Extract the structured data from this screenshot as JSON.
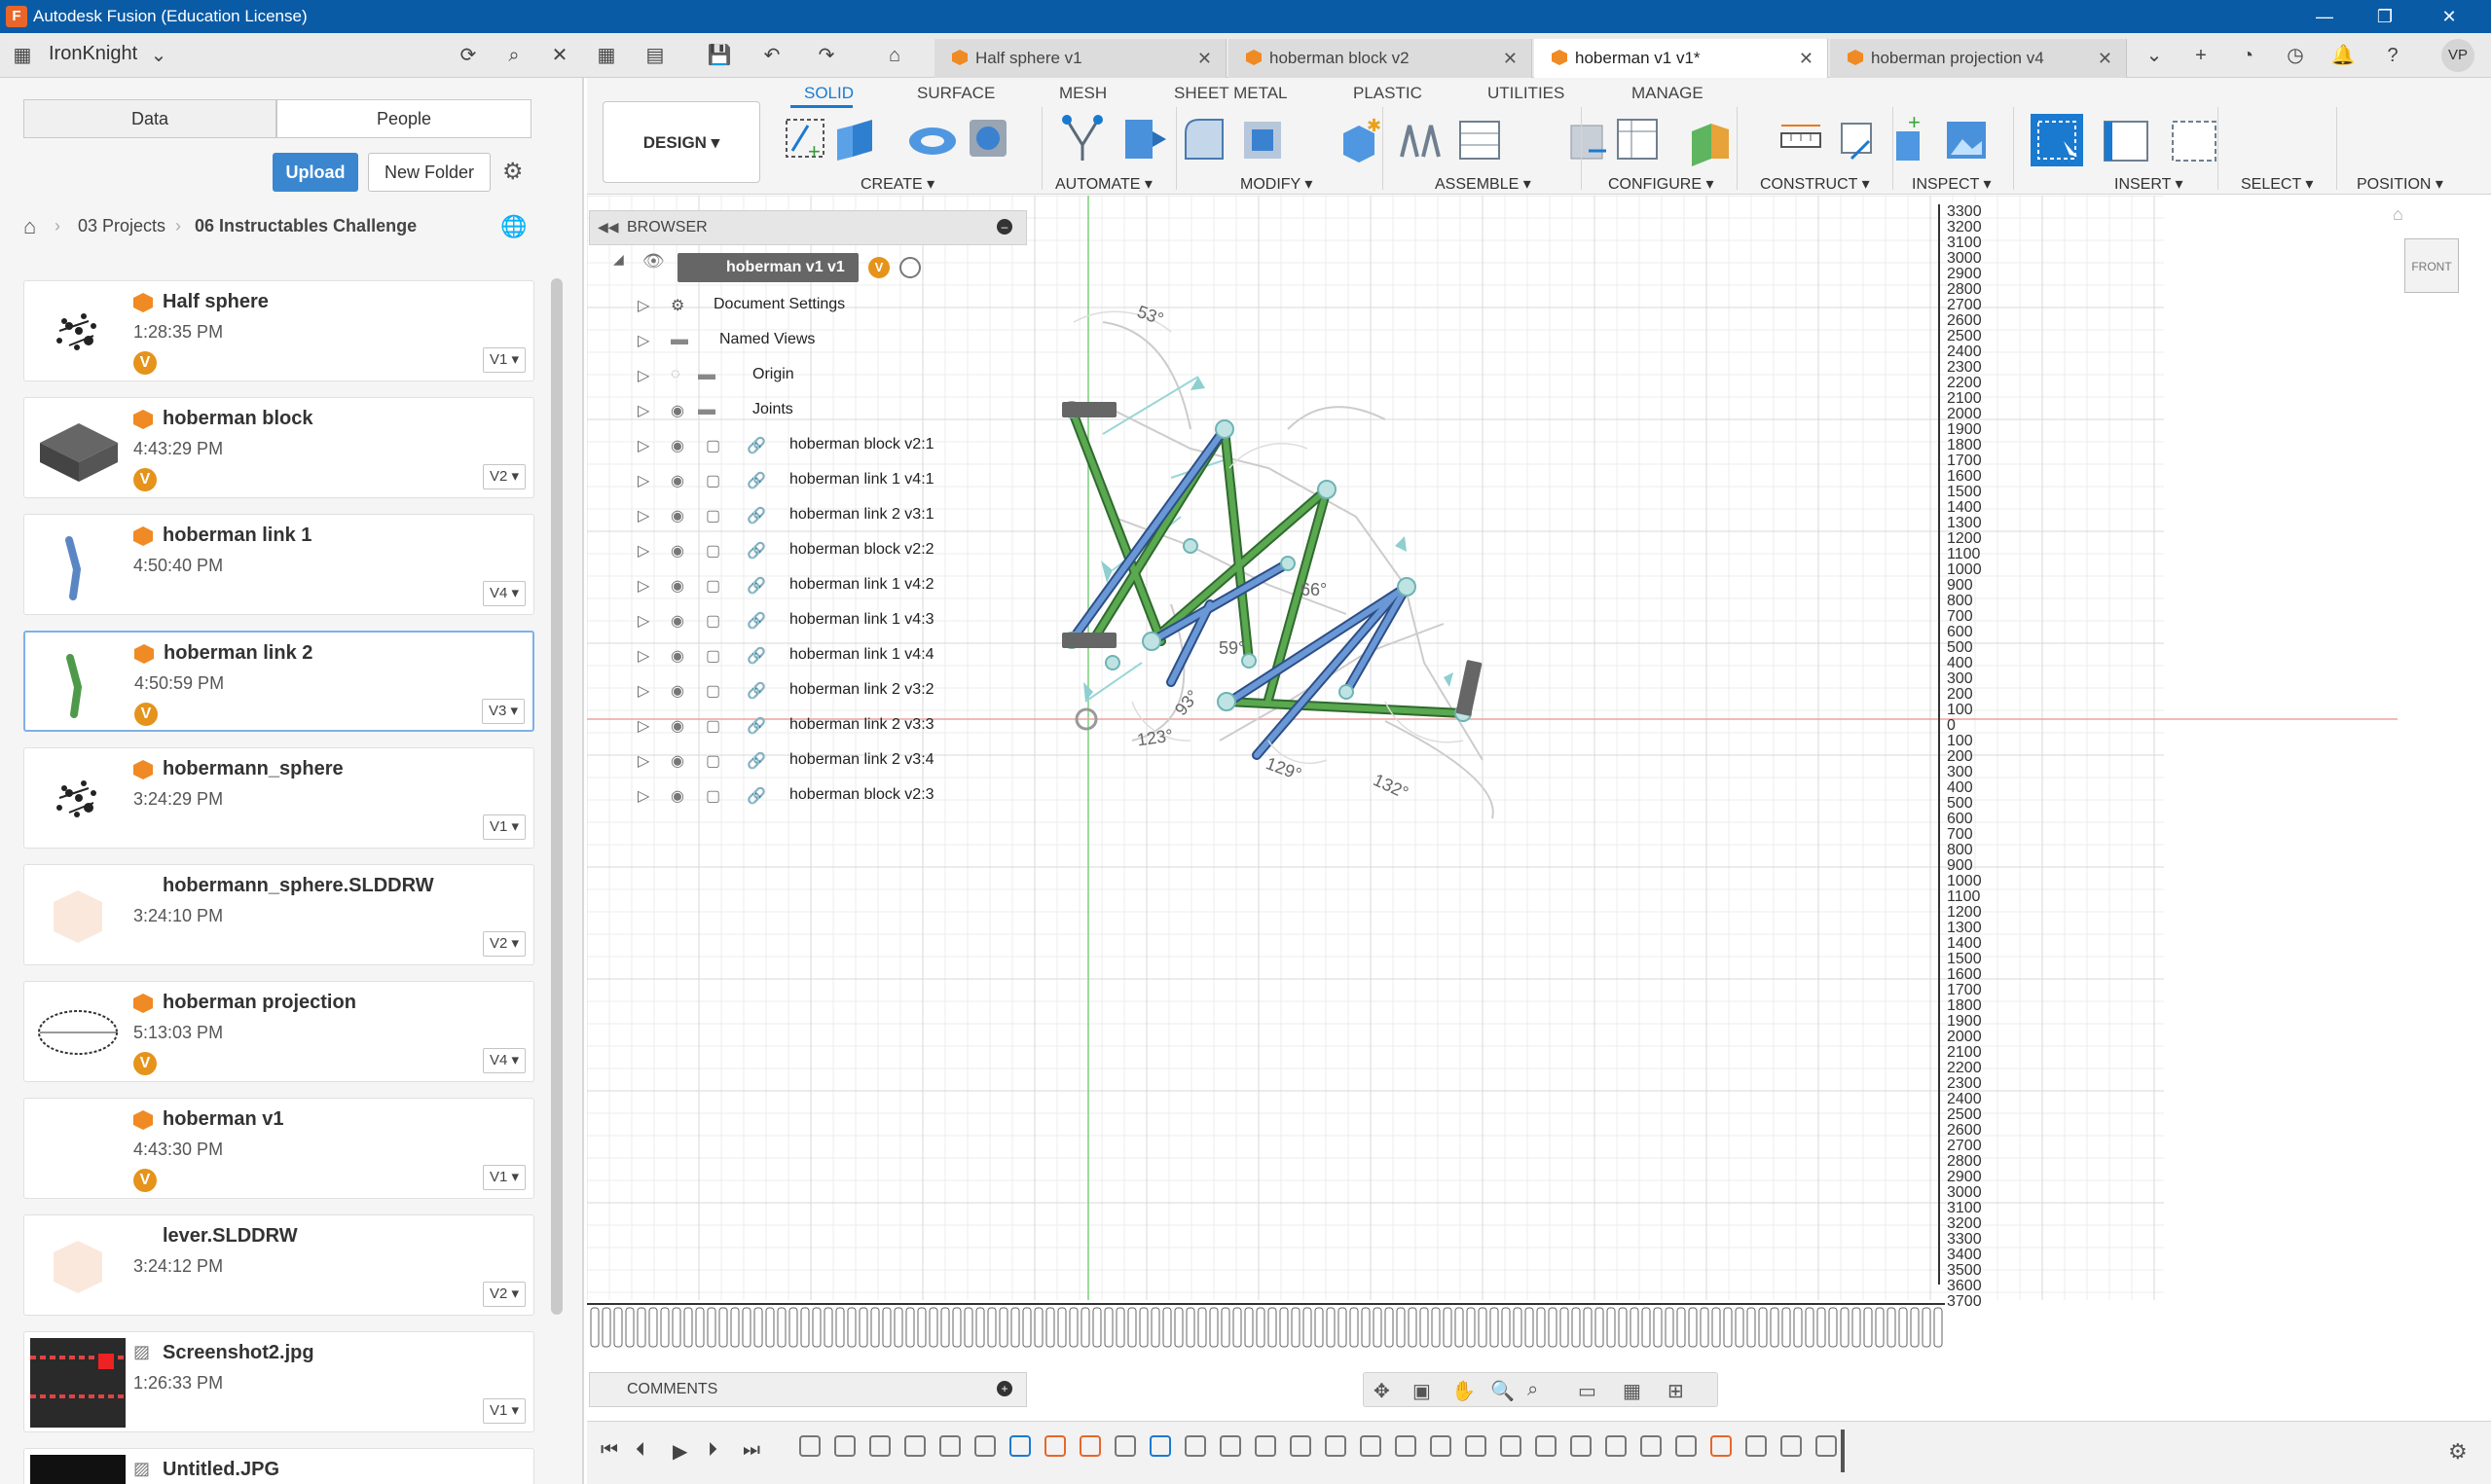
{
  "window": {
    "title": "Autodesk Fusion (Education License)",
    "app_icon": "F"
  },
  "topbar": {
    "user": "IronKnight",
    "avatar": "VP"
  },
  "tabs": [
    {
      "label": "Half sphere v1",
      "active": false
    },
    {
      "label": "hoberman block v2",
      "active": false
    },
    {
      "label": "hoberman v1 v1*",
      "active": true
    },
    {
      "label": "hoberman projection v4",
      "active": false
    }
  ],
  "data_panel": {
    "segments": [
      "Data",
      "People"
    ],
    "upload": "Upload",
    "new_folder": "New Folder",
    "breadcrumb": [
      "03 Projects",
      "06 Instructables Challenge"
    ],
    "files": [
      {
        "name": "Half sphere",
        "time": "1:28:35 PM",
        "version": "V1",
        "badge": "V",
        "icon": "fusion-cube",
        "thumb": "sphere-scatter"
      },
      {
        "name": "hoberman block",
        "time": "4:43:29 PM",
        "version": "V2",
        "badge": "V",
        "icon": "fusion-cube",
        "thumb": "block"
      },
      {
        "name": "hoberman link 1",
        "time": "4:50:40 PM",
        "version": "V4",
        "badge": "",
        "icon": "fusion-cube",
        "thumb": "link-blue"
      },
      {
        "name": "hoberman link 2",
        "time": "4:50:59 PM",
        "version": "V3",
        "badge": "V",
        "icon": "fusion-cube",
        "thumb": "link-green"
      },
      {
        "name": "hobermann_sphere",
        "time": "3:24:29 PM",
        "version": "V1",
        "badge": "",
        "icon": "fusion-cube",
        "thumb": "sphere-scatter"
      },
      {
        "name": "hobermann_sphere.SLDDRW",
        "time": "3:24:10 PM",
        "version": "V2",
        "badge": "",
        "icon": "",
        "thumb": "blank-cube"
      },
      {
        "name": "hoberman projection",
        "time": "5:13:03 PM",
        "version": "V4",
        "badge": "V",
        "icon": "fusion-cube",
        "thumb": "ring"
      },
      {
        "name": "hoberman v1",
        "time": "4:43:30 PM",
        "version": "V1",
        "badge": "V",
        "icon": "fusion-cube",
        "thumb": "empty"
      },
      {
        "name": "lever.SLDDRW",
        "time": "3:24:12 PM",
        "version": "V2",
        "badge": "",
        "icon": "",
        "thumb": "blank-cube"
      },
      {
        "name": "Screenshot2.jpg",
        "time": "1:26:33 PM",
        "version": "V1",
        "badge": "",
        "icon": "image-icon",
        "thumb": "photo"
      },
      {
        "name": "Untitled.JPG",
        "time": "",
        "version": "",
        "badge": "",
        "icon": "image-icon",
        "thumb": "photo2"
      }
    ]
  },
  "ribbon": {
    "workspace": "DESIGN",
    "tabs": [
      "SOLID",
      "SURFACE",
      "MESH",
      "SHEET METAL",
      "PLASTIC",
      "UTILITIES",
      "MANAGE"
    ],
    "active_tab": "SOLID",
    "groups": [
      "CREATE",
      "AUTOMATE",
      "MODIFY",
      "ASSEMBLE",
      "CONFIGURE",
      "CONSTRUCT",
      "INSPECT",
      "INSERT",
      "SELECT",
      "POSITION"
    ]
  },
  "browser": {
    "title": "BROWSER",
    "root": "hoberman v1 v1",
    "items": [
      "Document Settings",
      "Named Views",
      "Origin",
      "Joints",
      "hoberman block v2:1",
      "hoberman link 1 v4:1",
      "hoberman link 2 v3:1",
      "hoberman block v2:2",
      "hoberman link 1 v4:2",
      "hoberman link 1 v4:3",
      "hoberman link 1 v4:4",
      "hoberman link 2 v3:2",
      "hoberman link 2 v3:3",
      "hoberman link 2 v3:4",
      "hoberman block v2:3"
    ]
  },
  "comments": "COMMENTS",
  "viewcube": "FRONT",
  "angles": [
    "53°",
    "123°",
    "129°",
    "132°",
    "93°",
    "66°",
    "59°"
  ],
  "ruler_right": [
    "3300",
    "3200",
    "3100",
    "3000",
    "2900",
    "2800",
    "2700",
    "2600",
    "2500",
    "2400",
    "2300",
    "2200",
    "2100",
    "2000",
    "1900",
    "1800",
    "1700",
    "1600",
    "1500",
    "1400",
    "1300",
    "1200",
    "1100",
    "1000",
    "900",
    "800",
    "700",
    "600",
    "500",
    "400",
    "300",
    "200",
    "100",
    "0",
    "100",
    "200",
    "300",
    "400",
    "500",
    "600",
    "700",
    "800",
    "900",
    "1000",
    "1100",
    "1200",
    "1300",
    "1400",
    "1500",
    "1600",
    "1700",
    "1800",
    "1900",
    "2000",
    "2100",
    "2200",
    "2300",
    "2400",
    "2500",
    "2600",
    "2700",
    "2800",
    "2900",
    "3000",
    "3100",
    "3200",
    "3300",
    "3400",
    "3500",
    "3600",
    "3700"
  ],
  "colors": {
    "titlebar": "#0a5ba6",
    "accent": "#1a7ad0",
    "link_green": "#4f9a4a",
    "link_blue": "#5b86c4",
    "grid": "#e3e3e3"
  }
}
